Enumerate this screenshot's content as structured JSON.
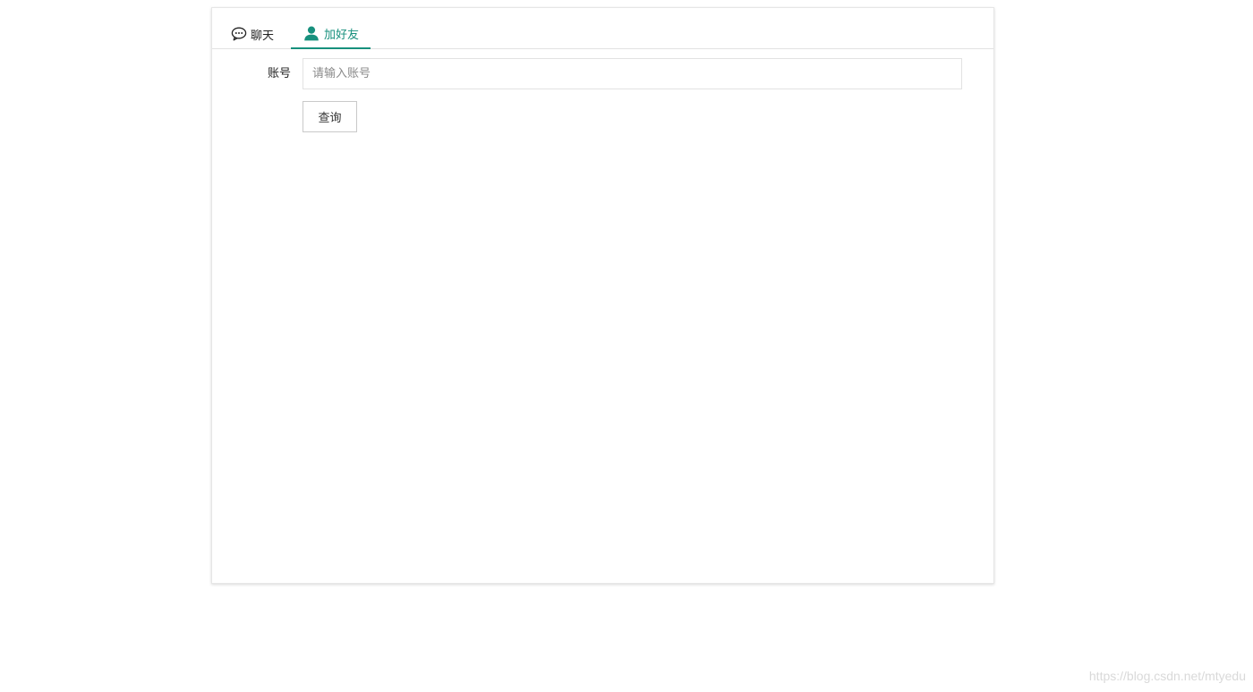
{
  "tabs": [
    {
      "label": "聊天",
      "icon": "chat-icon",
      "active": false
    },
    {
      "label": "加好友",
      "icon": "user-icon",
      "active": true
    }
  ],
  "form": {
    "account_label": "账号",
    "account_placeholder": "请输入账号",
    "account_value": "",
    "query_label": "查询"
  },
  "watermark": "https://blog.csdn.net/mtyedu",
  "colors": {
    "accent": "#17907d",
    "border": "#e2e2e2",
    "text": "#222222",
    "watermark": "#d9d9d9"
  }
}
